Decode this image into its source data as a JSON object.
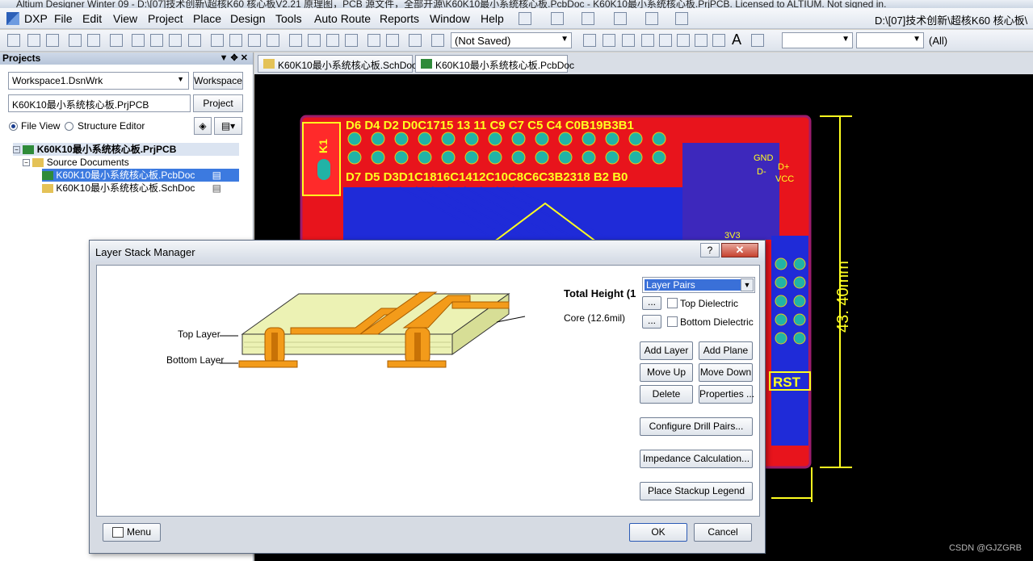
{
  "window": {
    "title": "Altium Designer Winter 09 - D:\\[07]技术创新\\超核K60 核心板V2.21 原理图，PCB 源文件，全部开源\\K60K10最小系统核心板.PcbDoc - K60K10最小系统核心板.PrjPCB. Licensed to ALTIUM. Not signed in."
  },
  "menu": {
    "items": [
      "DXP",
      "File",
      "Edit",
      "View",
      "Project",
      "Place",
      "Design",
      "Tools",
      "Auto Route",
      "Reports",
      "Window",
      "Help"
    ],
    "path": "D:\\[07]技术创新\\超核K60 核心板\\"
  },
  "toolbar": {
    "save_state": "(Not Saved)",
    "filter_all": "(All)"
  },
  "projects": {
    "panel_title": "Projects",
    "workspace_value": "Workspace1.DsnWrk",
    "workspace_button": "Workspace",
    "project_value": "K60K10最小系统核心板.PrjPCB",
    "project_button": "Project",
    "view_file": "File View",
    "view_structure": "Structure Editor",
    "tree": {
      "root": "K60K10最小系统核心板.PrjPCB",
      "folder": "Source Documents",
      "files": [
        "K60K10最小系统核心板.PcbDoc",
        "K60K10最小系统核心板.SchDoc"
      ]
    }
  },
  "doc_tabs": [
    "K60K10最小系统核心板.SchDoc",
    "K60K10最小系统核心板.PcbDoc"
  ],
  "pcb": {
    "top_row_label": "D6 D4 D2 D0C1715 13 11 C9 C7 C5 C4 C0B19B3B1",
    "bottom_row_label": "D7 D5 D3D1C1816C1412C10C8C6C3B2318 B2 B0",
    "ref_k1": "K1",
    "label_gnd": "GND",
    "label_dplus": "D+",
    "label_dminus": "D-",
    "label_vcc": "VCC",
    "label_3v3": "3V3",
    "label_rst": "RST",
    "dimension": "43. 40mm"
  },
  "dialog": {
    "title": "Layer Stack Manager",
    "help": "?",
    "close": "✕",
    "total_height": "Total Height (1",
    "core_label": "Core (12.6mil)",
    "top_layer_label": "Top Layer",
    "bottom_layer_label": "Bottom Layer",
    "layer_pairs": "Layer Pairs",
    "ellipsis": "...",
    "top_dielectric": "Top Dielectric",
    "bottom_dielectric": "Bottom Dielectric",
    "buttons": {
      "add_layer": "Add Layer",
      "add_plane": "Add Plane",
      "move_up": "Move Up",
      "move_down": "Move Down",
      "delete": "Delete",
      "properties": "Properties ...",
      "configure_drill_pairs": "Configure Drill Pairs...",
      "impedance_calculation": "Impedance Calculation...",
      "place_stackup_legend": "Place Stackup Legend",
      "menu": "Menu",
      "ok": "OK",
      "cancel": "Cancel"
    }
  },
  "watermark": "CSDN @GJZGRB",
  "colors": {
    "pcb_red": "#e8141c",
    "pcb_blue": "#1f2bd8",
    "pcb_yellow": "#ffff20",
    "pcb_pad": "#21b3a6",
    "board_outline": "#9b1d6d",
    "copper": "#f39b1a",
    "core": "#ecf2b4"
  }
}
